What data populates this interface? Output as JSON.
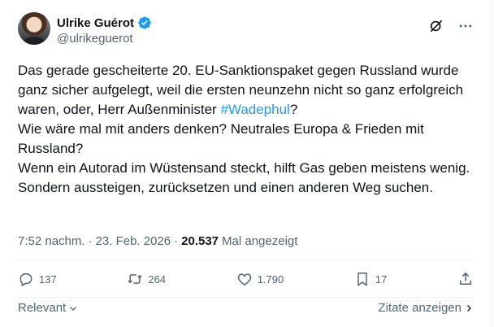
{
  "author": {
    "name": "Ulrike Guérot",
    "handle": "@ulrikeguerot",
    "verified_color": "#1d9bf0"
  },
  "tweet": {
    "text_before": "Das gerade gescheiterte 20. EU-Sanktionspaket gegen Russland wurde ganz sicher aufgelegt, weil die ersten neunzehn nicht so ganz erfolgreich waren, oder, Herr Außenminister ",
    "hashtag": "#Wadephul",
    "text_after": "?\nWie wäre mal mit anders denken? Neutrales Europa & Frieden mit Russland?\nWenn ein Autorad im Wüstensand steckt, hilft Gas geben meistens wenig. Sondern aussteigen, zurücksetzen und einen anderen Weg suchen.",
    "time": "7:52 nachm.",
    "separator": "·",
    "date": "23. Feb. 2026",
    "views": "20.537",
    "views_label": "Mal angezeigt"
  },
  "actions": {
    "replies": "137",
    "reposts": "264",
    "likes": "1.790",
    "bookmarks": "17"
  },
  "footer": {
    "relevance_label": "Relevant",
    "quotes_label": "Zitate anzeigen"
  },
  "icons": [
    "verified-badge-icon",
    "grok-icon",
    "more-icon",
    "reply-icon",
    "repost-icon",
    "like-icon",
    "bookmark-icon",
    "share-icon",
    "chevron-down-icon",
    "chevron-right-icon"
  ]
}
